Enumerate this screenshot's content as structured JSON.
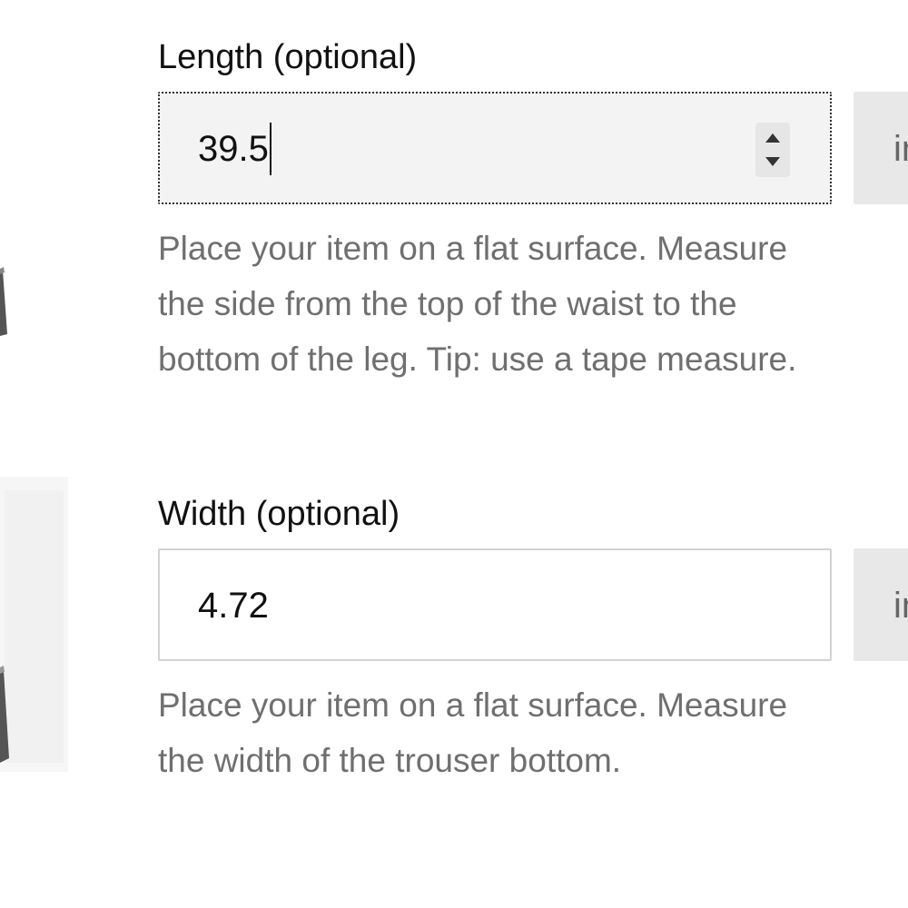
{
  "length_field": {
    "label": "Length (optional)",
    "value": "39.5",
    "unit": "in",
    "help_lines": [
      "Place your item on a flat surface. Measure",
      "the side from the top of the waist to the",
      "bottom of the leg. Tip: use a tape measure."
    ]
  },
  "width_field": {
    "label": "Width (optional)",
    "value": "4.72",
    "unit": "in",
    "help_lines": [
      "Place your item on a flat surface. Measure",
      "the width of the trouser bottom."
    ]
  },
  "icons": {
    "stepper": "number-stepper-icon",
    "illustration": "trouser-illustration"
  },
  "colors": {
    "label": "#111111",
    "help_text": "#6f6f6f",
    "focused_input_bg": "#f3f3f3",
    "unit_bg": "#e8e8e8",
    "input_border": "#d2d2d2"
  }
}
